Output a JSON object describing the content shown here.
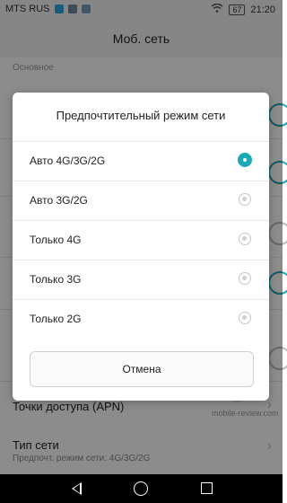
{
  "status_bar": {
    "carrier": "MTS RUS",
    "battery": "67",
    "time": "21:20"
  },
  "title_bar": {
    "title": "Моб. сеть"
  },
  "background": {
    "section_label": "Основное",
    "row_apn": "Точки доступа (APN)",
    "row_network_type": "Тип сети",
    "row_network_type_sub": "Предпочт. режим сети: 4G/3G/2G"
  },
  "dialog": {
    "title": "Предпочтительный режим сети",
    "options": [
      {
        "label": "Авто 4G/3G/2G",
        "selected": true
      },
      {
        "label": "Авто 3G/2G",
        "selected": false
      },
      {
        "label": "Только 4G",
        "selected": false
      },
      {
        "label": "Только 3G",
        "selected": false
      },
      {
        "label": "Только 2G",
        "selected": false
      }
    ],
    "cancel_label": "Отмена"
  },
  "watermark": {
    "text": "mobile-review.com"
  },
  "colors": {
    "accent": "#1aa9b5"
  }
}
